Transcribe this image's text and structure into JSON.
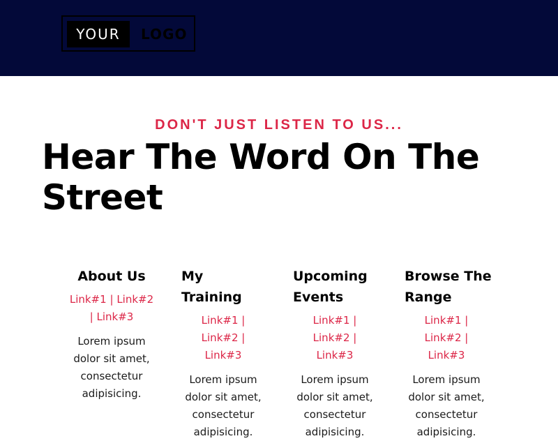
{
  "header": {
    "logo_left": "YOUR",
    "logo_right": "LOGO",
    "background_color": "#030939"
  },
  "section": {
    "eyebrow": "DON'T JUST LISTEN TO US...",
    "heading": "Hear The Word On The Street"
  },
  "columns": [
    {
      "title": "About Us",
      "links": [
        "Link#1",
        "Link#2",
        "Link#3"
      ],
      "body": "Lorem ipsum dolor sit amet, consectetur adipisicing."
    },
    {
      "title": "My Training",
      "links": [
        "Link#1",
        "Link#2",
        "Link#3"
      ],
      "body": "Lorem ipsum dolor sit amet, consectetur adipisicing."
    },
    {
      "title": "Upcoming Events",
      "links": [
        "Link#1",
        "Link#2",
        "Link#3"
      ],
      "body": "Lorem ipsum dolor sit amet, consectetur adipisicing."
    },
    {
      "title": "Browse The Range",
      "links": [
        "Link#1",
        "Link#2",
        "Link#3"
      ],
      "body": "Lorem ipsum dolor sit amet, consectetur adipisicing."
    }
  ],
  "colors": {
    "accent": "#dc2647",
    "text": "#000000"
  }
}
